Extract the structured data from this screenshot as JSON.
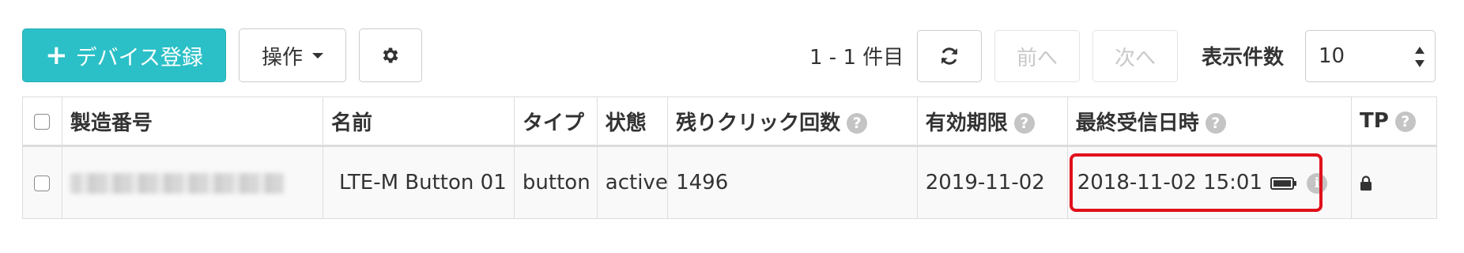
{
  "toolbar": {
    "add_device_label": "デバイス登録",
    "operations_label": "操作",
    "range_text": "1 - 1 件目",
    "prev_label": "前へ",
    "next_label": "次へ",
    "per_page_label": "表示件数",
    "per_page_value": "10",
    "add_device_icon": "plus-icon",
    "settings_icon": "gear-icon",
    "refresh_icon": "refresh-icon",
    "accent_color": "#2bc0c7"
  },
  "table": {
    "columns": [
      {
        "label": "製造番号",
        "help": false
      },
      {
        "label": "名前",
        "help": false
      },
      {
        "label": "タイプ",
        "help": false
      },
      {
        "label": "状態",
        "help": false
      },
      {
        "label": "残りクリック回数",
        "help": true
      },
      {
        "label": "有効期限",
        "help": true
      },
      {
        "label": "最終受信日時",
        "help": true
      },
      {
        "label": "TP",
        "help": true
      }
    ],
    "help_glyph": "?",
    "rows": [
      {
        "name": "LTE-M Button 01",
        "type": "button",
        "status": "active",
        "remaining_clicks": "1496",
        "expiry": "2019-11-02",
        "last_received": "2018-11-02 15:01",
        "battery_icon": "battery-full-icon",
        "info_icon": "info-icon",
        "tp_icon": "lock-icon"
      }
    ],
    "info_glyph": "i",
    "highlight_color": "#e0111b"
  }
}
